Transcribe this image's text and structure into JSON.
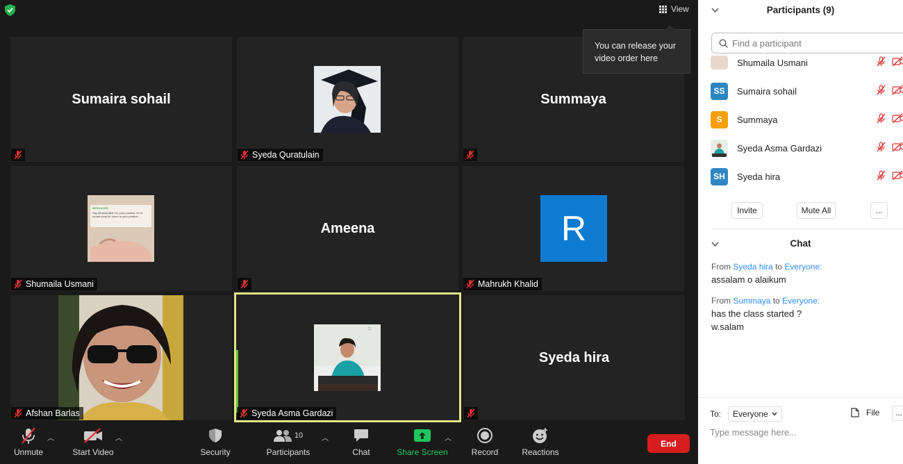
{
  "view_button": "View",
  "tooltip": "You can release your video order here",
  "tiles": [
    {
      "display_name": "Sumaira sohail",
      "label": ""
    },
    {
      "display_name": "",
      "label": "Syeda Quratulain"
    },
    {
      "display_name": "Summaya",
      "label": ""
    },
    {
      "display_name": "",
      "label": "Shumaila Usmani"
    },
    {
      "display_name": "Ameena",
      "label": ""
    },
    {
      "display_name": "",
      "label": "Mahrukh Khalid",
      "avatar_letter": "R"
    },
    {
      "display_name": "",
      "label": "Afshan Barlas"
    },
    {
      "display_name": "",
      "label": "Syeda Asma Gardazi"
    },
    {
      "display_name": "Syeda hira",
      "label": ""
    }
  ],
  "photo_texts": {
    "messages_header": "MESSAGES",
    "messages_body": "Say Alhamdulillah for your position, lot of people pray for come to your position"
  },
  "toolbar": {
    "unmute": "Unmute",
    "start_video": "Start Video",
    "security": "Security",
    "participants": "Participants",
    "participants_count": "10",
    "chat": "Chat",
    "share_screen": "Share Screen",
    "record": "Record",
    "reactions": "Reactions",
    "end": "End"
  },
  "colors": {
    "share_green": "#21c55d",
    "end_red": "#d71d1d",
    "active_border": "#dfe685",
    "link_blue": "#2d8cff",
    "avatar_blue": "#2e86c1",
    "avatar_orange": "#f59f0b",
    "tile_blue": "#0e7bd3"
  },
  "participants_panel": {
    "title": "Participants (9)",
    "search_placeholder": "Find a participant",
    "list": [
      {
        "name": "Shumaila Usmani",
        "initials": ""
      },
      {
        "name": "Sumaira sohail",
        "initials": "SS"
      },
      {
        "name": "Summaya",
        "initials": "S"
      },
      {
        "name": "Syeda Asma Gardazi",
        "initials": ""
      },
      {
        "name": "Syeda hira",
        "initials": "SH"
      }
    ],
    "invite": "Invite",
    "mute_all": "Mute All",
    "more": "..."
  },
  "chat_panel": {
    "title": "Chat",
    "messages": [
      {
        "from_prefix": "From",
        "from": "Syeda hira",
        "to_prefix": "to",
        "to": "Everyone:",
        "lines": [
          "assalam o alaikum"
        ]
      },
      {
        "from_prefix": "From",
        "from": "Summaya",
        "to_prefix": "to",
        "to": "Everyone:",
        "lines": [
          "has the class started ?",
          "w.salam"
        ]
      }
    ],
    "to_label": "To:",
    "to_value": "Everyone",
    "file": "File",
    "more": "...",
    "input_placeholder": "Type message here..."
  }
}
